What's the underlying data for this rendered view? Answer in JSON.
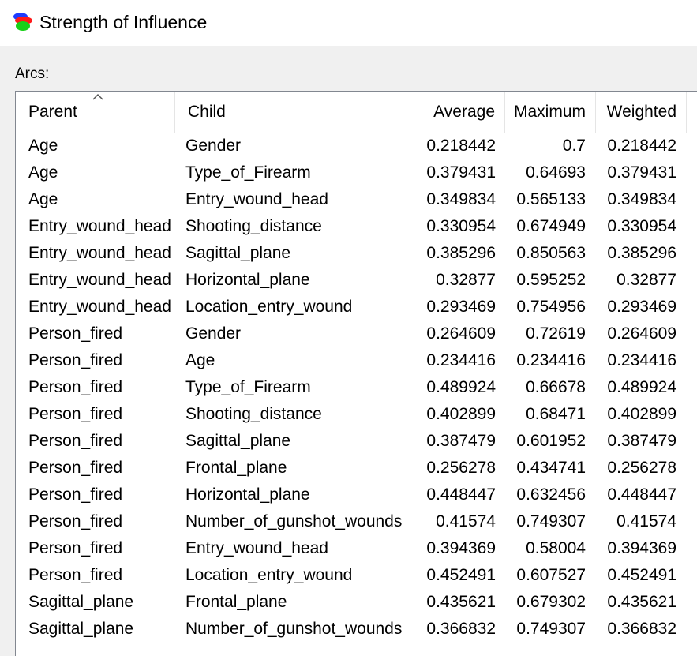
{
  "window": {
    "title": "Strength of Influence",
    "icon": "network-app-icon"
  },
  "arcs_label": "Arcs:",
  "columns": {
    "parent": "Parent",
    "child": "Child",
    "average": "Average",
    "maximum": "Maximum",
    "weighted": "Weighted"
  },
  "sort_indicator": "ascending",
  "rows": [
    {
      "parent": "Age",
      "child": "Gender",
      "average": "0.218442",
      "maximum": "0.7",
      "weighted": "0.218442"
    },
    {
      "parent": "Age",
      "child": "Type_of_Firearm",
      "average": "0.379431",
      "maximum": "0.64693",
      "weighted": "0.379431"
    },
    {
      "parent": "Age",
      "child": "Entry_wound_head",
      "average": "0.349834",
      "maximum": "0.565133",
      "weighted": "0.349834"
    },
    {
      "parent": "Entry_wound_head",
      "child": "Shooting_distance",
      "average": "0.330954",
      "maximum": "0.674949",
      "weighted": "0.330954"
    },
    {
      "parent": "Entry_wound_head",
      "child": "Sagittal_plane",
      "average": "0.385296",
      "maximum": "0.850563",
      "weighted": "0.385296"
    },
    {
      "parent": "Entry_wound_head",
      "child": "Horizontal_plane",
      "average": "0.32877",
      "maximum": "0.595252",
      "weighted": "0.32877"
    },
    {
      "parent": "Entry_wound_head",
      "child": "Location_entry_wound",
      "average": "0.293469",
      "maximum": "0.754956",
      "weighted": "0.293469"
    },
    {
      "parent": "Person_fired",
      "child": "Gender",
      "average": "0.264609",
      "maximum": "0.72619",
      "weighted": "0.264609"
    },
    {
      "parent": "Person_fired",
      "child": "Age",
      "average": "0.234416",
      "maximum": "0.234416",
      "weighted": "0.234416"
    },
    {
      "parent": "Person_fired",
      "child": "Type_of_Firearm",
      "average": "0.489924",
      "maximum": "0.66678",
      "weighted": "0.489924"
    },
    {
      "parent": "Person_fired",
      "child": "Shooting_distance",
      "average": "0.402899",
      "maximum": "0.68471",
      "weighted": "0.402899"
    },
    {
      "parent": "Person_fired",
      "child": "Sagittal_plane",
      "average": "0.387479",
      "maximum": "0.601952",
      "weighted": "0.387479"
    },
    {
      "parent": "Person_fired",
      "child": "Frontal_plane",
      "average": "0.256278",
      "maximum": "0.434741",
      "weighted": "0.256278"
    },
    {
      "parent": "Person_fired",
      "child": "Horizontal_plane",
      "average": "0.448447",
      "maximum": "0.632456",
      "weighted": "0.448447"
    },
    {
      "parent": "Person_fired",
      "child": "Number_of_gunshot_wounds",
      "average": "0.41574",
      "maximum": "0.749307",
      "weighted": "0.41574"
    },
    {
      "parent": "Person_fired",
      "child": "Entry_wound_head",
      "average": "0.394369",
      "maximum": "0.58004",
      "weighted": "0.394369"
    },
    {
      "parent": "Person_fired",
      "child": "Location_entry_wound",
      "average": "0.452491",
      "maximum": "0.607527",
      "weighted": "0.452491"
    },
    {
      "parent": "Sagittal_plane",
      "child": "Frontal_plane",
      "average": "0.435621",
      "maximum": "0.679302",
      "weighted": "0.435621"
    },
    {
      "parent": "Sagittal_plane",
      "child": "Number_of_gunshot_wounds",
      "average": "0.366832",
      "maximum": "0.749307",
      "weighted": "0.366832"
    }
  ]
}
